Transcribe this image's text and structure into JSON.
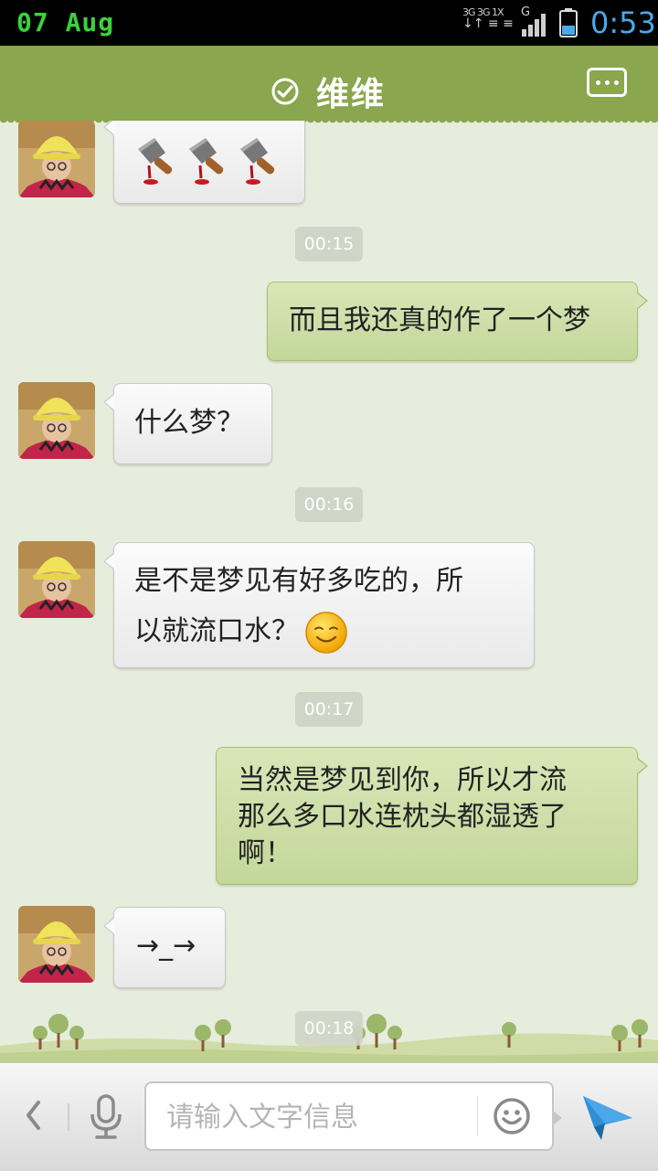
{
  "status_bar": {
    "date": "07 Aug",
    "network_label_1": "3G 3G 1X",
    "network_label_2": "G",
    "time": "0:53",
    "icons": [
      "data-arrows-icon",
      "signal-bars-icon",
      "battery-icon"
    ]
  },
  "header": {
    "title": "维维",
    "verified_icon": "check-circle-icon",
    "more_icon": "more-dots-icon"
  },
  "messages": [
    {
      "side": "in",
      "type": "stickers",
      "content": [
        "cleaver-emoji",
        "cleaver-emoji",
        "cleaver-emoji"
      ]
    },
    {
      "side": "time",
      "text": "00:15"
    },
    {
      "side": "out",
      "text": "而且我还真的作了一个梦"
    },
    {
      "side": "in",
      "text": "什么梦？"
    },
    {
      "side": "time",
      "text": "00:16"
    },
    {
      "side": "in",
      "text_line1": "是不是梦见有好多吃的，所",
      "text_line2": "以就流口水？",
      "emoji": "smile-emoji"
    },
    {
      "side": "time",
      "text": "00:17"
    },
    {
      "side": "out",
      "text_line1": "当然是梦见到你，所以才流",
      "text_line2": "那么多口水连枕头都湿透了",
      "text_line3": "啊！"
    },
    {
      "side": "in",
      "text": "→_→"
    },
    {
      "side": "time",
      "text": "00:18"
    }
  ],
  "input_bar": {
    "placeholder": "请输入文字信息",
    "icons": [
      "chevron-left-icon",
      "microphone-icon",
      "emoji-icon",
      "send-icon"
    ]
  },
  "colors": {
    "header_green": "#8aa64e",
    "chat_background": "#e7eddc",
    "outgoing_bubble": "#c8dba2",
    "incoming_bubble": "#f3f3f3",
    "status_date_green": "#3bd23b",
    "status_time_blue": "#4aa9e8",
    "send_blue": "#2f8fd6"
  }
}
